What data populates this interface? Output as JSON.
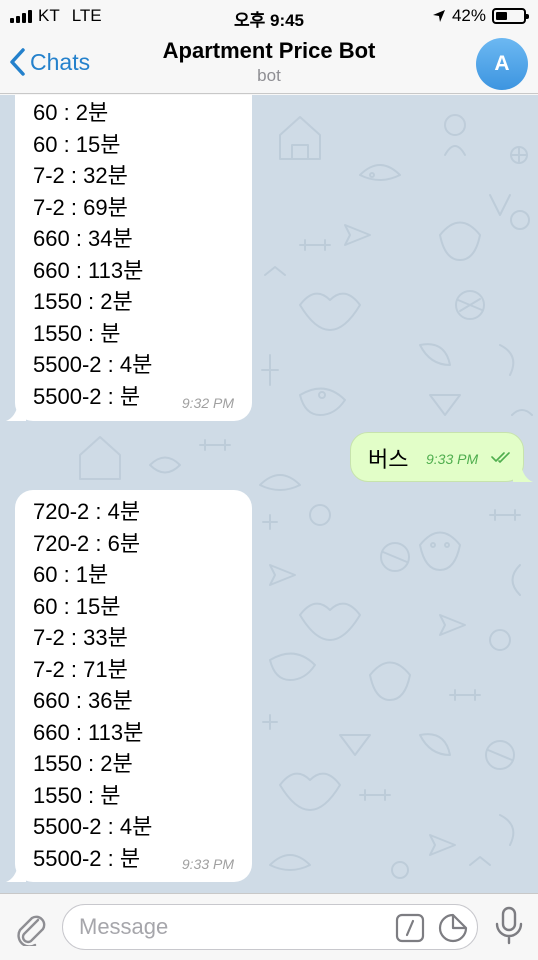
{
  "status_bar": {
    "carrier": "KT",
    "network": "LTE",
    "time": "오후 9:45",
    "battery": "42%",
    "battery_level": 0.42
  },
  "header": {
    "back_label": "Chats",
    "title": "Apartment Price Bot",
    "subtitle": "bot",
    "avatar_letter": "A"
  },
  "messages": [
    {
      "direction": "incoming",
      "lines": [
        "60 : 2분",
        "60 : 15분",
        "7-2 : 32분",
        "7-2 : 69분",
        "660 : 34분",
        "660 : 113분",
        "1550 : 2분",
        "1550 : 분",
        "5500-2 : 4분",
        "5500-2 : 분"
      ],
      "time": "9:32 PM"
    },
    {
      "direction": "outgoing",
      "text": "버스",
      "time": "9:33 PM",
      "status": "read"
    },
    {
      "direction": "incoming",
      "lines": [
        "720-2 : 4분",
        "720-2 : 6분",
        "60 : 1분",
        "60 : 15분",
        "7-2 : 33분",
        "7-2 : 71분",
        "660 : 36분",
        "660 : 113분",
        "1550 : 2분",
        "1550 : 분",
        "5500-2 : 4분",
        "5500-2 : 분"
      ],
      "time": "9:33 PM"
    }
  ],
  "input": {
    "placeholder": "Message"
  },
  "colors": {
    "accent": "#2481cc",
    "chat_background": "#cfdbe6",
    "outgoing_bubble": "#e2fec8",
    "incoming_bubble": "#ffffff"
  }
}
